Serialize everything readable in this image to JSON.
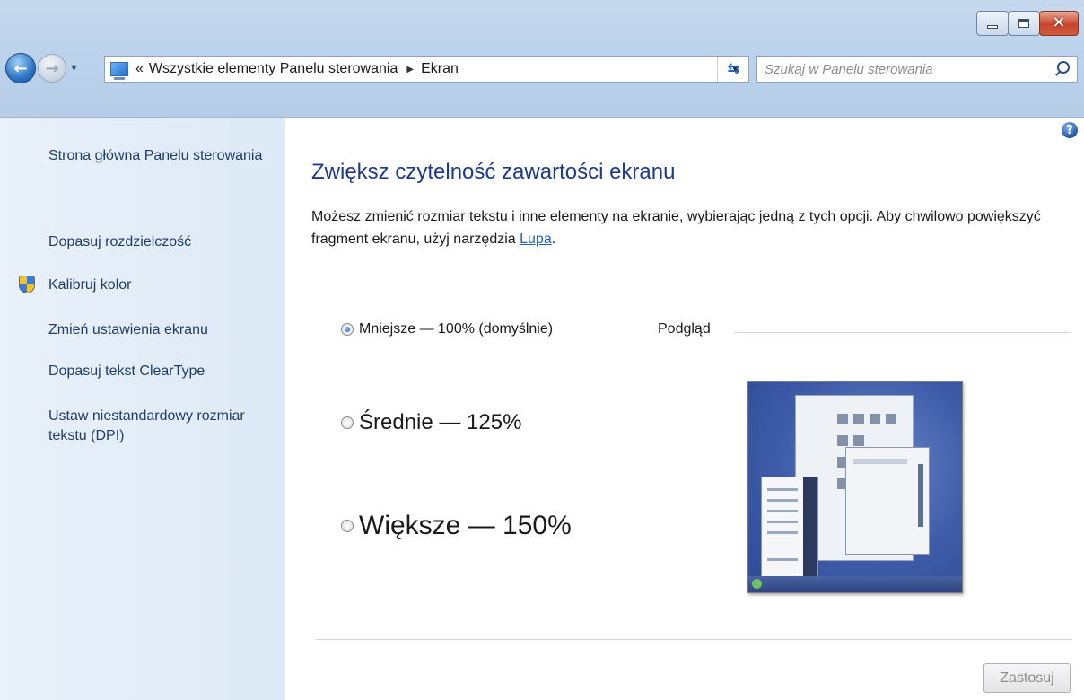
{
  "window": {
    "caption_buttons": [
      "minimize-icon",
      "maximize-icon",
      "close-icon"
    ]
  },
  "navigation": {
    "back_icon": "back-arrow-icon",
    "forward_icon": "forward-arrow-icon",
    "address": {
      "icon": "control-panel-icon",
      "overflow_marker": "«",
      "breadcrumbs": [
        "Wszystkie elementy Panelu sterowania",
        "Ekran"
      ]
    },
    "refresh_icon": "refresh-icon",
    "search": {
      "placeholder": "Szukaj w Panelu sterowania",
      "value": ""
    }
  },
  "sidebar": {
    "items": [
      {
        "label": "Strona główna Panelu sterowania"
      },
      {
        "label": "Dopasuj rozdzielczość"
      },
      {
        "label": "Kalibruj kolor",
        "icon": "shield-icon"
      },
      {
        "label": "Zmień ustawienia ekranu"
      },
      {
        "label": "Dopasuj tekst ClearType"
      },
      {
        "label": "Ustaw niestandardowy rozmiar tekstu (DPI)"
      }
    ]
  },
  "main": {
    "title": "Zwiększ czytelność zawartości ekranu",
    "description_before": "Możesz zmienić rozmiar tekstu i inne elementy na ekranie, wybierając jedną z tych opcji. Aby chwilowo powiększyć fragment ekranu, użyj narzędzia ",
    "description_link": "Lupa",
    "description_after": ".",
    "options": [
      {
        "label": "Mniejsze — 100% (domyślnie)",
        "selected": true
      },
      {
        "label": "Średnie — 125%",
        "selected": false
      },
      {
        "label": "Większe — 150%",
        "selected": false
      }
    ],
    "preview_label": "Podgląd",
    "apply_label": "Zastosuj",
    "help_icon": "help-icon"
  },
  "colors": {
    "title_blue": "#1e3a8c",
    "link_blue": "#1f5fbf",
    "sidebar_bg": "#e4eef8",
    "chrome_bg": "#bcd3ec"
  }
}
